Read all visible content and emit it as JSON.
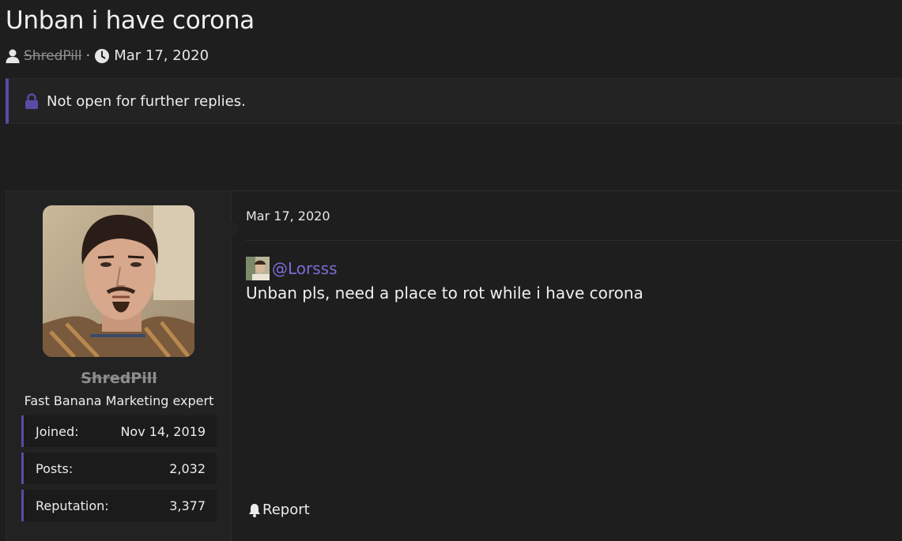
{
  "thread": {
    "title": "Unban i have corona",
    "author": "ShredPill",
    "separator": "·",
    "date": "Mar 17, 2020"
  },
  "notice": {
    "text": "Not open for further replies."
  },
  "post": {
    "date": "Mar 17, 2020",
    "mention": "@Lorsss",
    "body": "Unban pls, need a place to rot while i have corona",
    "report_label": "Report"
  },
  "user": {
    "name": "ShredPill",
    "title": "Fast Banana Marketing expert",
    "stats": [
      {
        "label": "Joined:",
        "value": "Nov 14, 2019"
      },
      {
        "label": "Posts:",
        "value": "2,032"
      },
      {
        "label": "Reputation:",
        "value": "3,377"
      }
    ]
  },
  "colors": {
    "accent": "#5b4aa6",
    "mention": "#7d6bd6",
    "background": "#1e1e1e"
  },
  "icons": {
    "author": "user-icon",
    "date": "clock-icon",
    "notice": "lock-icon",
    "report": "bell-icon"
  }
}
